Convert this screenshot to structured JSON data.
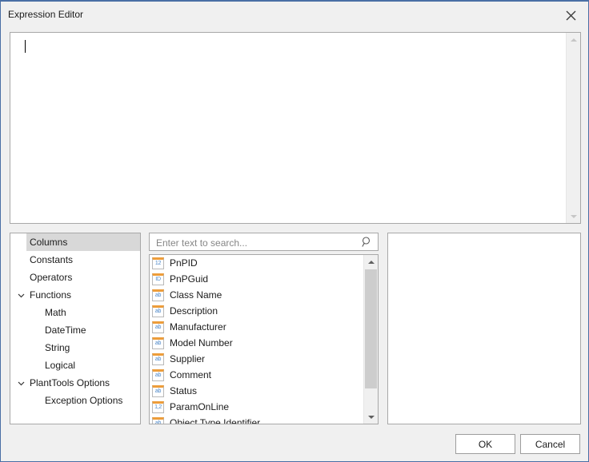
{
  "window": {
    "title": "Expression Editor",
    "close_icon": "close-icon",
    "accent_color": "#4a6fa5",
    "background_color": "#f0f0f0"
  },
  "editor": {
    "value": "",
    "caret_visible": true,
    "scrollbar": {
      "up_arrow": "scroll-up-arrow",
      "down_arrow": "scroll-down-arrow",
      "enabled": false
    }
  },
  "tree": {
    "items": [
      {
        "label": "Columns",
        "level": 0,
        "selected": true,
        "expander": ""
      },
      {
        "label": "Constants",
        "level": 0,
        "selected": false,
        "expander": ""
      },
      {
        "label": "Operators",
        "level": 0,
        "selected": false,
        "expander": ""
      },
      {
        "label": "Functions",
        "level": 0,
        "selected": false,
        "expander": "chevron-down-icon"
      },
      {
        "label": "Math",
        "level": 1,
        "selected": false,
        "expander": ""
      },
      {
        "label": "DateTime",
        "level": 1,
        "selected": false,
        "expander": ""
      },
      {
        "label": "String",
        "level": 1,
        "selected": false,
        "expander": ""
      },
      {
        "label": "Logical",
        "level": 1,
        "selected": false,
        "expander": ""
      },
      {
        "label": "PlantTools Options",
        "level": 0,
        "selected": false,
        "expander": "chevron-down-icon"
      },
      {
        "label": "Exception Options",
        "level": 1,
        "selected": false,
        "expander": ""
      }
    ],
    "selected_label": "Columns",
    "selection_color": "#d8d8d8"
  },
  "search": {
    "placeholder": "Enter text to search...",
    "value": "",
    "icon": "search-icon"
  },
  "list": {
    "items": [
      {
        "icon_text": "12",
        "icon_type": "integer-column-icon",
        "label": "PnPID"
      },
      {
        "icon_text": "ID",
        "icon_type": "guid-column-icon",
        "label": "PnPGuid"
      },
      {
        "icon_text": "ab",
        "icon_type": "text-column-icon",
        "label": "Class Name"
      },
      {
        "icon_text": "ab",
        "icon_type": "text-column-icon",
        "label": "Description"
      },
      {
        "icon_text": "ab",
        "icon_type": "text-column-icon",
        "label": "Manufacturer"
      },
      {
        "icon_text": "ab",
        "icon_type": "text-column-icon",
        "label": "Model Number"
      },
      {
        "icon_text": "ab",
        "icon_type": "text-column-icon",
        "label": "Supplier"
      },
      {
        "icon_text": "ab",
        "icon_type": "text-column-icon",
        "label": "Comment"
      },
      {
        "icon_text": "ab",
        "icon_type": "text-column-icon",
        "label": "Status"
      },
      {
        "icon_text": "1,2",
        "icon_type": "decimal-column-icon",
        "label": "ParamOnLine"
      },
      {
        "icon_text": "ab",
        "icon_type": "text-column-icon",
        "label": "Object Type Identifier"
      }
    ],
    "icon_accent_color": "#ed9d3a",
    "icon_text_color": "#4a86c8",
    "scrollbar": {
      "up_arrow": "scroll-up-arrow",
      "down_arrow": "scroll-down-arrow",
      "enabled": true
    }
  },
  "description": {
    "text": ""
  },
  "buttons": {
    "ok": "OK",
    "cancel": "Cancel"
  }
}
